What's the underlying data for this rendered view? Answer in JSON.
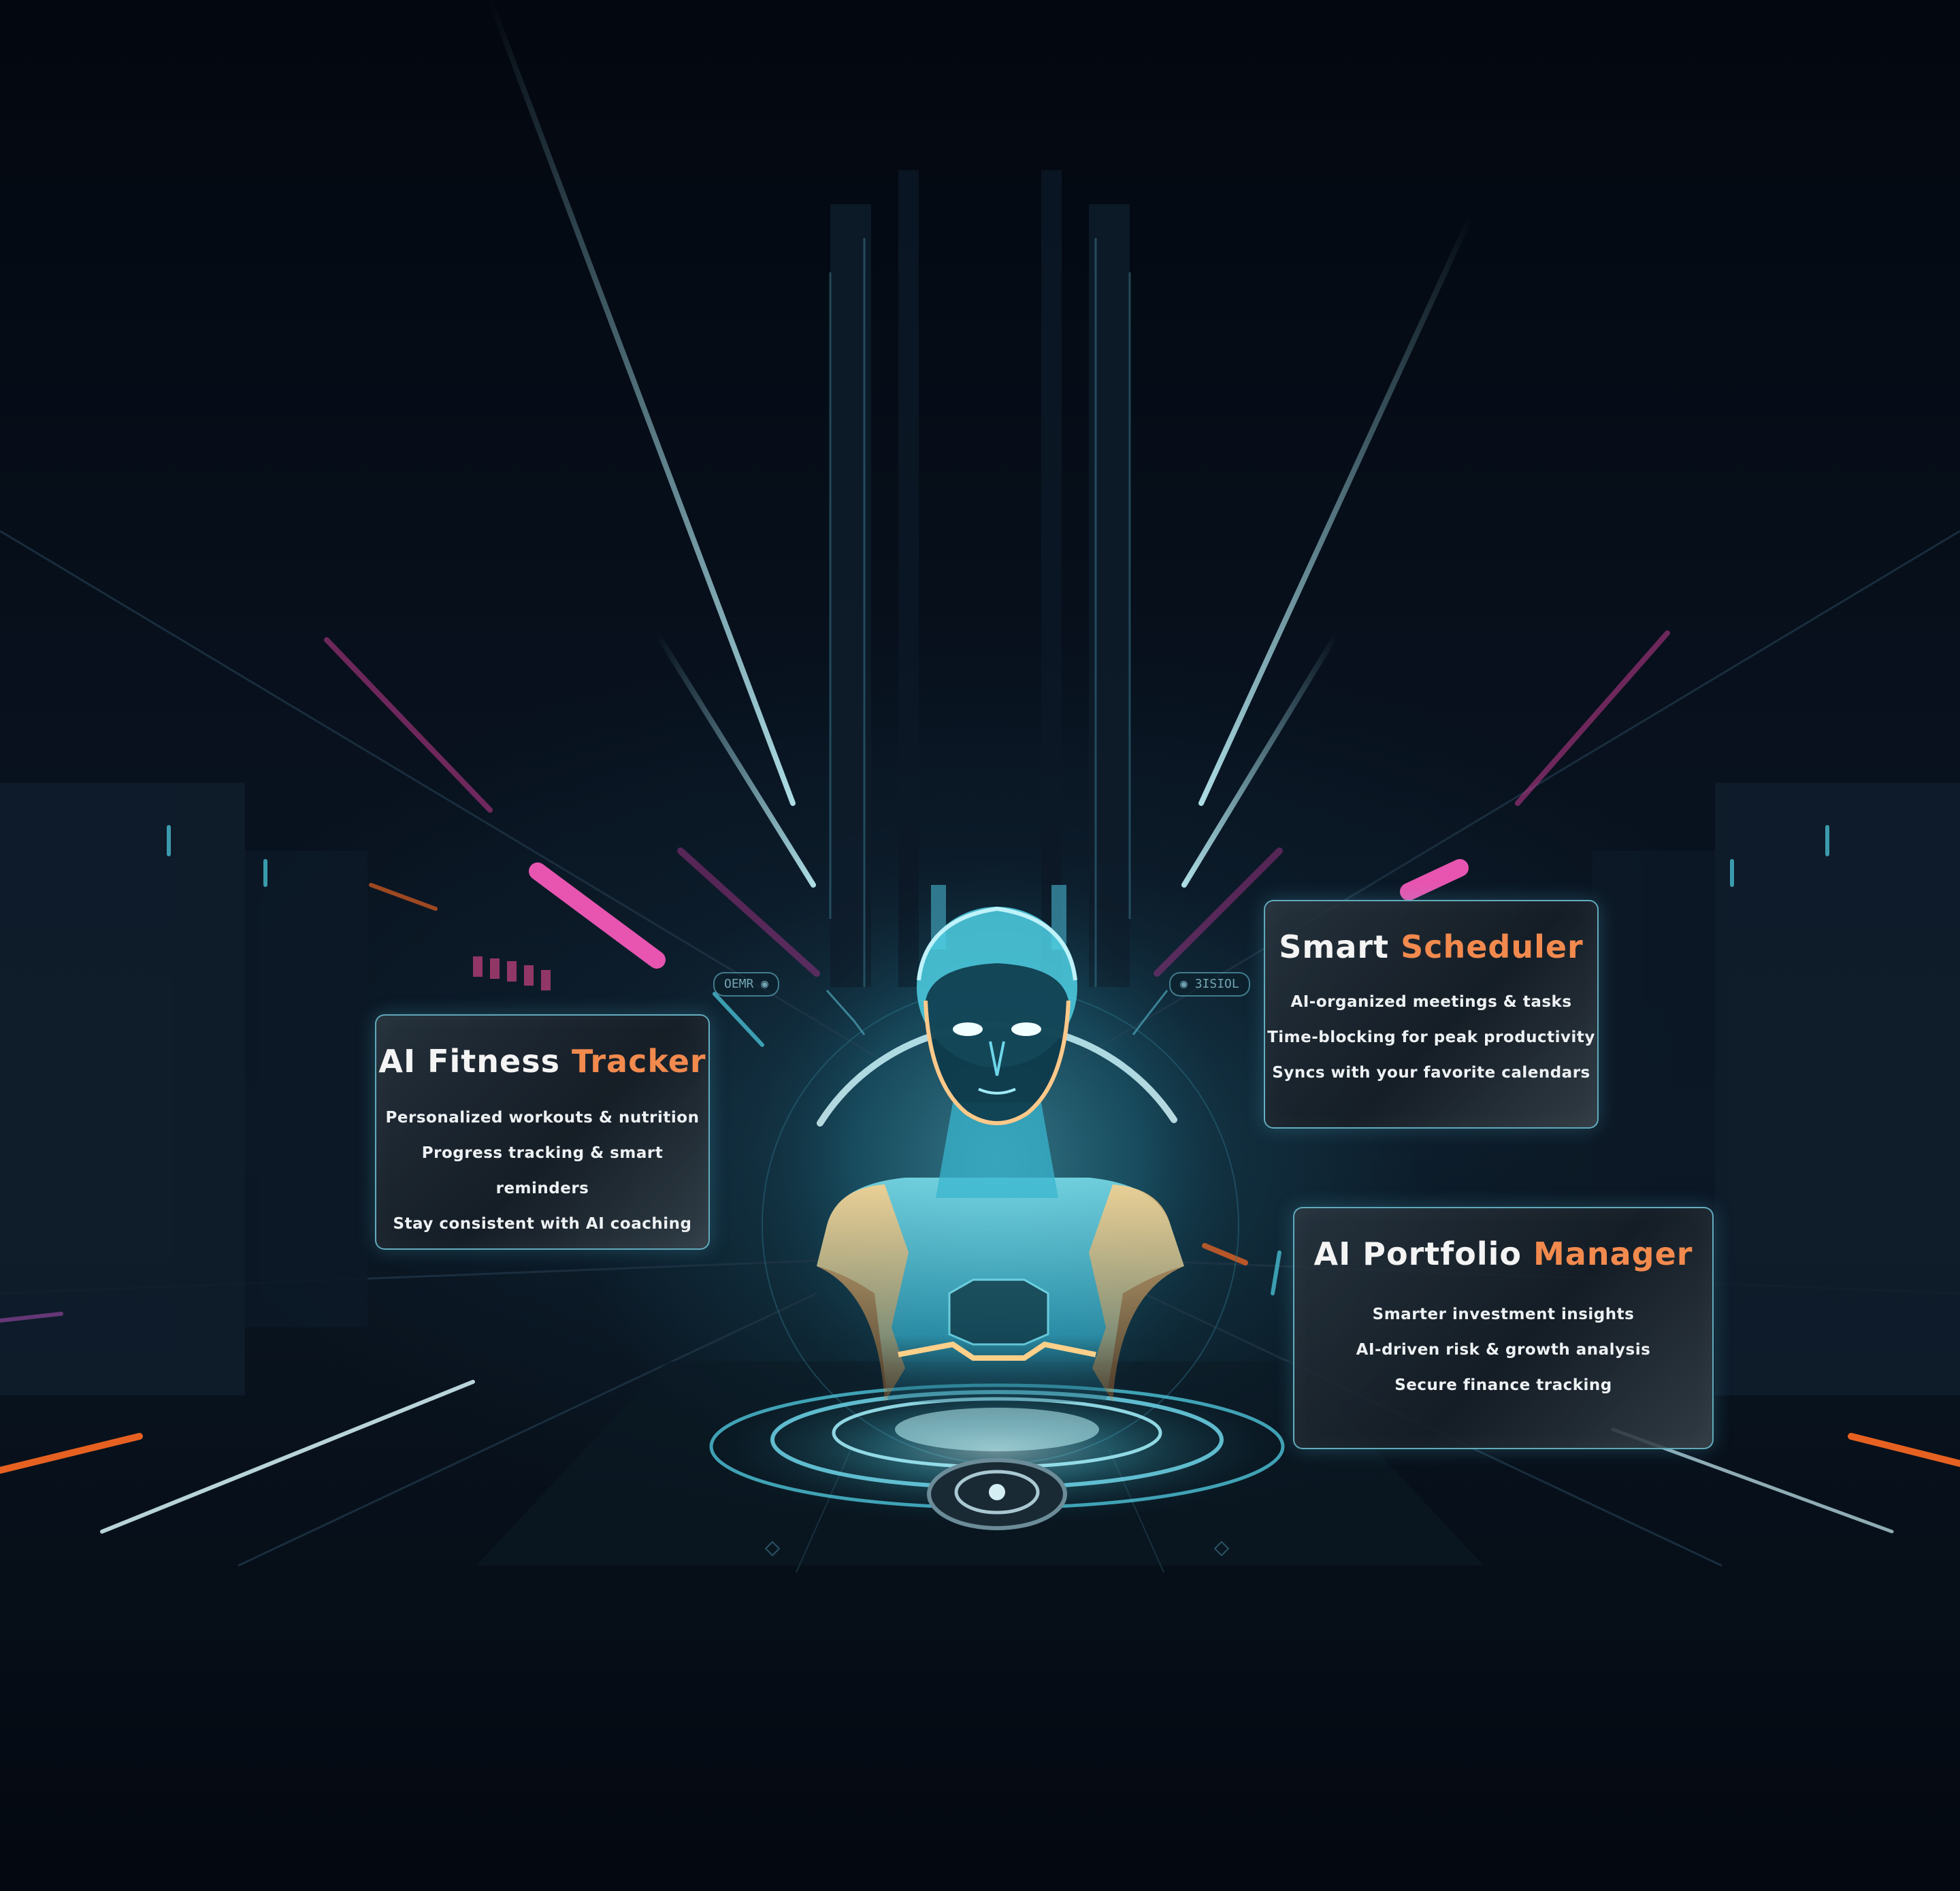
{
  "cards": [
    {
      "id": "fitness",
      "title_white": "AI Fitness",
      "title_orange": "Tracker",
      "items": [
        "Personalized workouts & nutrition",
        "Progress tracking & smart reminders",
        "Stay consistent with AI coaching"
      ]
    },
    {
      "id": "scheduler",
      "title_white": "Smart",
      "title_orange": "Scheduler",
      "items": [
        "AI-organized meetings & tasks",
        "Time-blocking for peak productivity",
        "Syncs with your favorite calendars"
      ]
    },
    {
      "id": "portfolio",
      "title_white": "AI Portfolio",
      "title_orange": "Manager",
      "items": [
        "Smarter investment insights",
        "AI-driven risk & growth analysis",
        "Secure finance tracking"
      ]
    }
  ],
  "hud_tags": [
    "OEMR",
    "3ISIOL"
  ],
  "colors": {
    "accent_orange": "#f28a4e",
    "accent_cyan": "#6fd6ea",
    "neon_pink": "#ff4fb8",
    "background": "#050a14"
  },
  "icons": [
    "ai-robot-hologram",
    "holo-platform"
  ]
}
